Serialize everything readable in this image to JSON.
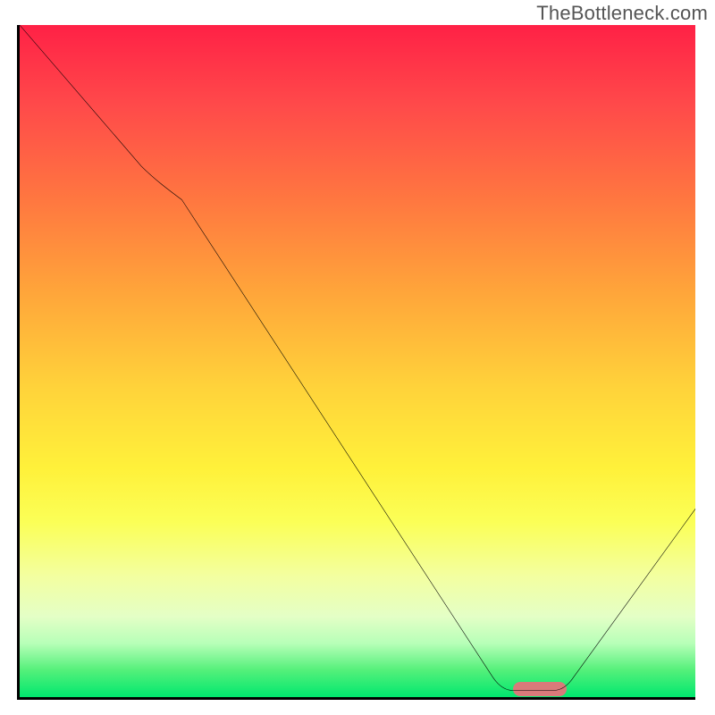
{
  "watermark": "TheBottleneck.com",
  "chart_data": {
    "type": "line",
    "title": "",
    "xlabel": "",
    "ylabel": "",
    "xlim": [
      0,
      100
    ],
    "ylim": [
      0,
      100
    ],
    "x": [
      0,
      18,
      24,
      70,
      73,
      79,
      82,
      100
    ],
    "y": [
      100,
      79,
      74,
      3,
      1,
      1,
      3,
      28
    ],
    "marker": {
      "x_start": 73,
      "x_end": 81,
      "y": 1
    },
    "gradient_stops": [
      {
        "pct": 0,
        "color": "#ff2146"
      },
      {
        "pct": 12,
        "color": "#ff4a4a"
      },
      {
        "pct": 26,
        "color": "#ff7740"
      },
      {
        "pct": 40,
        "color": "#ffa63a"
      },
      {
        "pct": 54,
        "color": "#ffd33a"
      },
      {
        "pct": 66,
        "color": "#fff13a"
      },
      {
        "pct": 74,
        "color": "#fbff57"
      },
      {
        "pct": 82,
        "color": "#f3ffa0"
      },
      {
        "pct": 88,
        "color": "#e4ffc6"
      },
      {
        "pct": 92,
        "color": "#b7ffb8"
      },
      {
        "pct": 96,
        "color": "#54f07a"
      },
      {
        "pct": 100,
        "color": "#00e86f"
      }
    ]
  }
}
